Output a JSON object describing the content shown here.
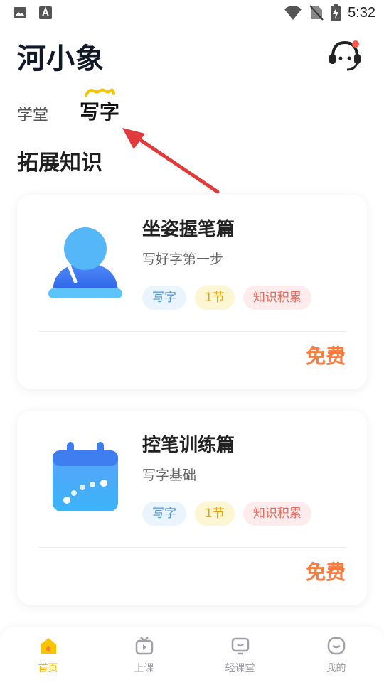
{
  "status_bar": {
    "time": "5:32",
    "icons": [
      "image-icon",
      "font-a-icon",
      "wifi-icon",
      "no-sim-icon",
      "battery-charging-icon"
    ]
  },
  "header": {
    "app_title": "河小象",
    "support_icon": "customer-service-icon"
  },
  "tabs": [
    {
      "label": "学堂",
      "active": false
    },
    {
      "label": "写字",
      "active": true
    }
  ],
  "section_title": "拓展知识",
  "colors": {
    "accent": "#f7b500",
    "price": "#ff7a3d",
    "annotation_arrow": "#e03a3a"
  },
  "courses": [
    {
      "title": "坐姿握笔篇",
      "subtitle": "写好字第一步",
      "tags": [
        "写字",
        "1节",
        "知识积累"
      ],
      "price": "免费",
      "icon": "sitting-posture-icon"
    },
    {
      "title": "控笔训练篇",
      "subtitle": "写字基础",
      "tags": [
        "写字",
        "1节",
        "知识积累"
      ],
      "price": "免费",
      "icon": "calendar-icon"
    }
  ],
  "bottom_nav": [
    {
      "label": "首页",
      "icon": "home-icon",
      "active": true
    },
    {
      "label": "上课",
      "icon": "tv-play-icon",
      "active": false
    },
    {
      "label": "轻课堂",
      "icon": "light-class-icon",
      "active": false
    },
    {
      "label": "我的",
      "icon": "profile-icon",
      "active": false
    }
  ]
}
